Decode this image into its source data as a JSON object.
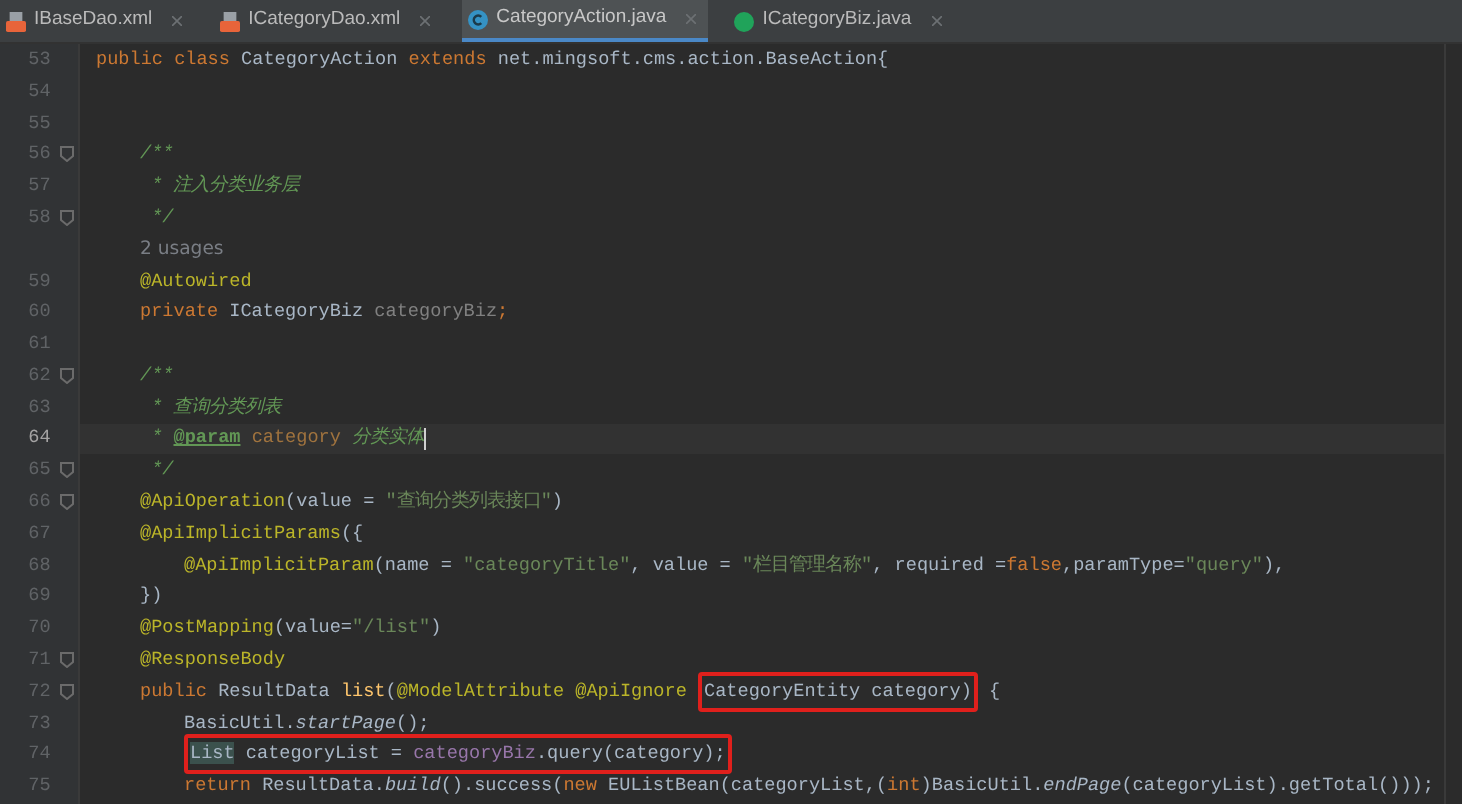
{
  "tabs": [
    {
      "label": "IBaseDao.xml",
      "kind": "xml",
      "selected": false
    },
    {
      "label": "ICategoryDao.xml",
      "kind": "xml",
      "selected": false
    },
    {
      "label": "CategoryAction.java",
      "kind": "class",
      "selected": true
    },
    {
      "label": "ICategoryBiz.java",
      "kind": "interface",
      "selected": false
    }
  ],
  "lines": [
    {
      "number": "53",
      "kind": "top",
      "fold": false,
      "current": false,
      "tokens": [
        {
          "t": "public ",
          "kind": "kw"
        },
        {
          "t": "class ",
          "kind": "kw"
        },
        {
          "t": "CategoryAction ",
          "kind": "plain"
        },
        {
          "t": "extends ",
          "kind": "kw"
        },
        {
          "t": "net.mingsoft.cms.action.BaseAction{",
          "kind": "plain"
        }
      ]
    },
    {
      "number": "54",
      "kind": "top",
      "fold": false,
      "current": false
    },
    {
      "number": "55",
      "kind": "top",
      "fold": false,
      "current": false
    },
    {
      "number": "56",
      "kind": "member",
      "fold": true,
      "current": false,
      "tokens": [
        {
          "t": "/**",
          "kind": "doc"
        }
      ]
    },
    {
      "number": "57",
      "kind": "member",
      "fold": false,
      "current": false,
      "tokens": [
        {
          "t": " * 注入分类业务层",
          "kind": "doc"
        }
      ]
    },
    {
      "number": "58",
      "kind": "member",
      "fold": true,
      "current": false,
      "tokens": [
        {
          "t": " */",
          "kind": "doc"
        }
      ]
    },
    {
      "kind": "member",
      "fold": false,
      "current": false,
      "tokens": [
        {
          "t": "2 usages",
          "kind": "hint"
        }
      ]
    },
    {
      "number": "59",
      "kind": "member",
      "fold": false,
      "current": false,
      "tokens": [
        {
          "t": "@Autowired",
          "kind": "ann"
        }
      ]
    },
    {
      "number": "60",
      "kind": "member",
      "fold": false,
      "current": false,
      "tokens": [
        {
          "t": "private ",
          "kind": "kw"
        },
        {
          "t": "ICategoryBiz ",
          "kind": "plain"
        },
        {
          "t": "categoryBiz",
          "kind": "unused"
        },
        {
          "t": ";",
          "kind": "kw"
        }
      ]
    },
    {
      "number": "61",
      "kind": "member",
      "fold": false,
      "current": false
    },
    {
      "number": "62",
      "kind": "member",
      "fold": true,
      "current": false,
      "tokens": [
        {
          "t": "/**",
          "kind": "doc"
        }
      ]
    },
    {
      "number": "63",
      "kind": "member",
      "fold": false,
      "current": false,
      "tokens": [
        {
          "t": " * 查询分类列表",
          "kind": "doc"
        }
      ]
    },
    {
      "number": "64",
      "kind": "member",
      "fold": false,
      "current": true,
      "tokens": [
        {
          "t": " * ",
          "kind": "doc"
        },
        {
          "t": "@param",
          "kind": "doctag"
        },
        {
          "t": " category",
          "kind": "docparam"
        },
        {
          "t": " 分类实体",
          "kind": "doc"
        }
      ]
    },
    {
      "number": "65",
      "kind": "member",
      "fold": true,
      "current": false,
      "tokens": [
        {
          "t": " */",
          "kind": "doc"
        }
      ]
    },
    {
      "number": "66",
      "kind": "member",
      "fold": true,
      "current": false,
      "tokens": [
        {
          "t": "@ApiOperation",
          "kind": "ann"
        },
        {
          "t": "(value = ",
          "kind": "plain"
        },
        {
          "t": "\"查询分类列表接口\"",
          "kind": "str"
        },
        {
          "t": ")",
          "kind": "plain"
        }
      ]
    },
    {
      "number": "67",
      "kind": "member",
      "fold": false,
      "current": false,
      "tokens": [
        {
          "t": "@ApiImplicitParams",
          "kind": "ann"
        },
        {
          "t": "({",
          "kind": "plain"
        }
      ]
    },
    {
      "number": "68",
      "kind": "statement",
      "fold": false,
      "current": false,
      "tokens": [
        {
          "t": "@ApiImplicitParam",
          "kind": "ann"
        },
        {
          "t": "(name = ",
          "kind": "plain"
        },
        {
          "t": "\"categoryTitle\"",
          "kind": "str"
        },
        {
          "t": ", value = ",
          "kind": "plain"
        },
        {
          "t": "\"栏目管理名称\"",
          "kind": "str"
        },
        {
          "t": ", required =",
          "kind": "plain"
        },
        {
          "t": "false",
          "kind": "kw"
        },
        {
          "t": ",paramType=",
          "kind": "plain"
        },
        {
          "t": "\"query\"",
          "kind": "str"
        },
        {
          "t": "),",
          "kind": "plain"
        }
      ]
    },
    {
      "number": "69",
      "kind": "member",
      "fold": false,
      "current": false,
      "tokens": [
        {
          "t": "})",
          "kind": "plain"
        }
      ]
    },
    {
      "number": "70",
      "kind": "member",
      "fold": false,
      "current": false,
      "tokens": [
        {
          "t": "@PostMapping",
          "kind": "ann"
        },
        {
          "t": "(value=",
          "kind": "plain"
        },
        {
          "t": "\"/list\"",
          "kind": "str"
        },
        {
          "t": ")",
          "kind": "plain"
        }
      ]
    },
    {
      "number": "71",
      "kind": "member",
      "fold": true,
      "current": false,
      "tokens": [
        {
          "t": "@ResponseBody",
          "kind": "ann"
        }
      ]
    },
    {
      "number": "72",
      "kind": "member",
      "fold": true,
      "current": false,
      "segments": [
        {
          "boxed": false,
          "tokens": [
            {
              "t": "public ",
              "kind": "kw"
            },
            {
              "t": "ResultData ",
              "kind": "plain"
            },
            {
              "t": "list",
              "kind": "method"
            },
            {
              "t": "(",
              "kind": "plain"
            },
            {
              "t": "@ModelAttribute ",
              "kind": "ann"
            },
            {
              "t": "@ApiIgnore ",
              "kind": "ann"
            }
          ]
        },
        {
          "boxed": true,
          "tokens": [
            {
              "t": "CategoryEntity category)",
              "kind": "plain"
            }
          ]
        },
        {
          "boxed": false,
          "tokens": [
            {
              "t": " {",
              "kind": "plain"
            }
          ]
        }
      ]
    },
    {
      "number": "73",
      "kind": "statement",
      "fold": false,
      "current": false,
      "tokens": [
        {
          "t": "BasicUtil.",
          "kind": "plain"
        },
        {
          "t": "startPage",
          "kind": "static"
        },
        {
          "t": "();",
          "kind": "plain"
        }
      ]
    },
    {
      "number": "74",
      "kind": "statement",
      "fold": false,
      "current": false,
      "segments": [
        {
          "boxed": true,
          "tokens": [
            {
              "t": "List",
              "kind": "usage"
            },
            {
              "t": " categoryList = ",
              "kind": "plain"
            },
            {
              "t": "categoryBiz",
              "kind": "field"
            },
            {
              "t": ".query(category);",
              "kind": "plain"
            }
          ]
        }
      ]
    },
    {
      "number": "75",
      "kind": "statement",
      "fold": false,
      "current": false,
      "tokens": [
        {
          "t": "return ",
          "kind": "kw"
        },
        {
          "t": "ResultData.",
          "kind": "plain"
        },
        {
          "t": "build",
          "kind": "static"
        },
        {
          "t": "().success(",
          "kind": "plain"
        },
        {
          "t": "new ",
          "kind": "kw"
        },
        {
          "t": "EUListBean(categoryList,(",
          "kind": "plain"
        },
        {
          "t": "int",
          "kind": "kw"
        },
        {
          "t": ")BasicUtil.",
          "kind": "plain"
        },
        {
          "t": "endPage",
          "kind": "static"
        },
        {
          "t": "(categoryList).getTotal()));",
          "kind": "plain"
        }
      ]
    }
  ]
}
